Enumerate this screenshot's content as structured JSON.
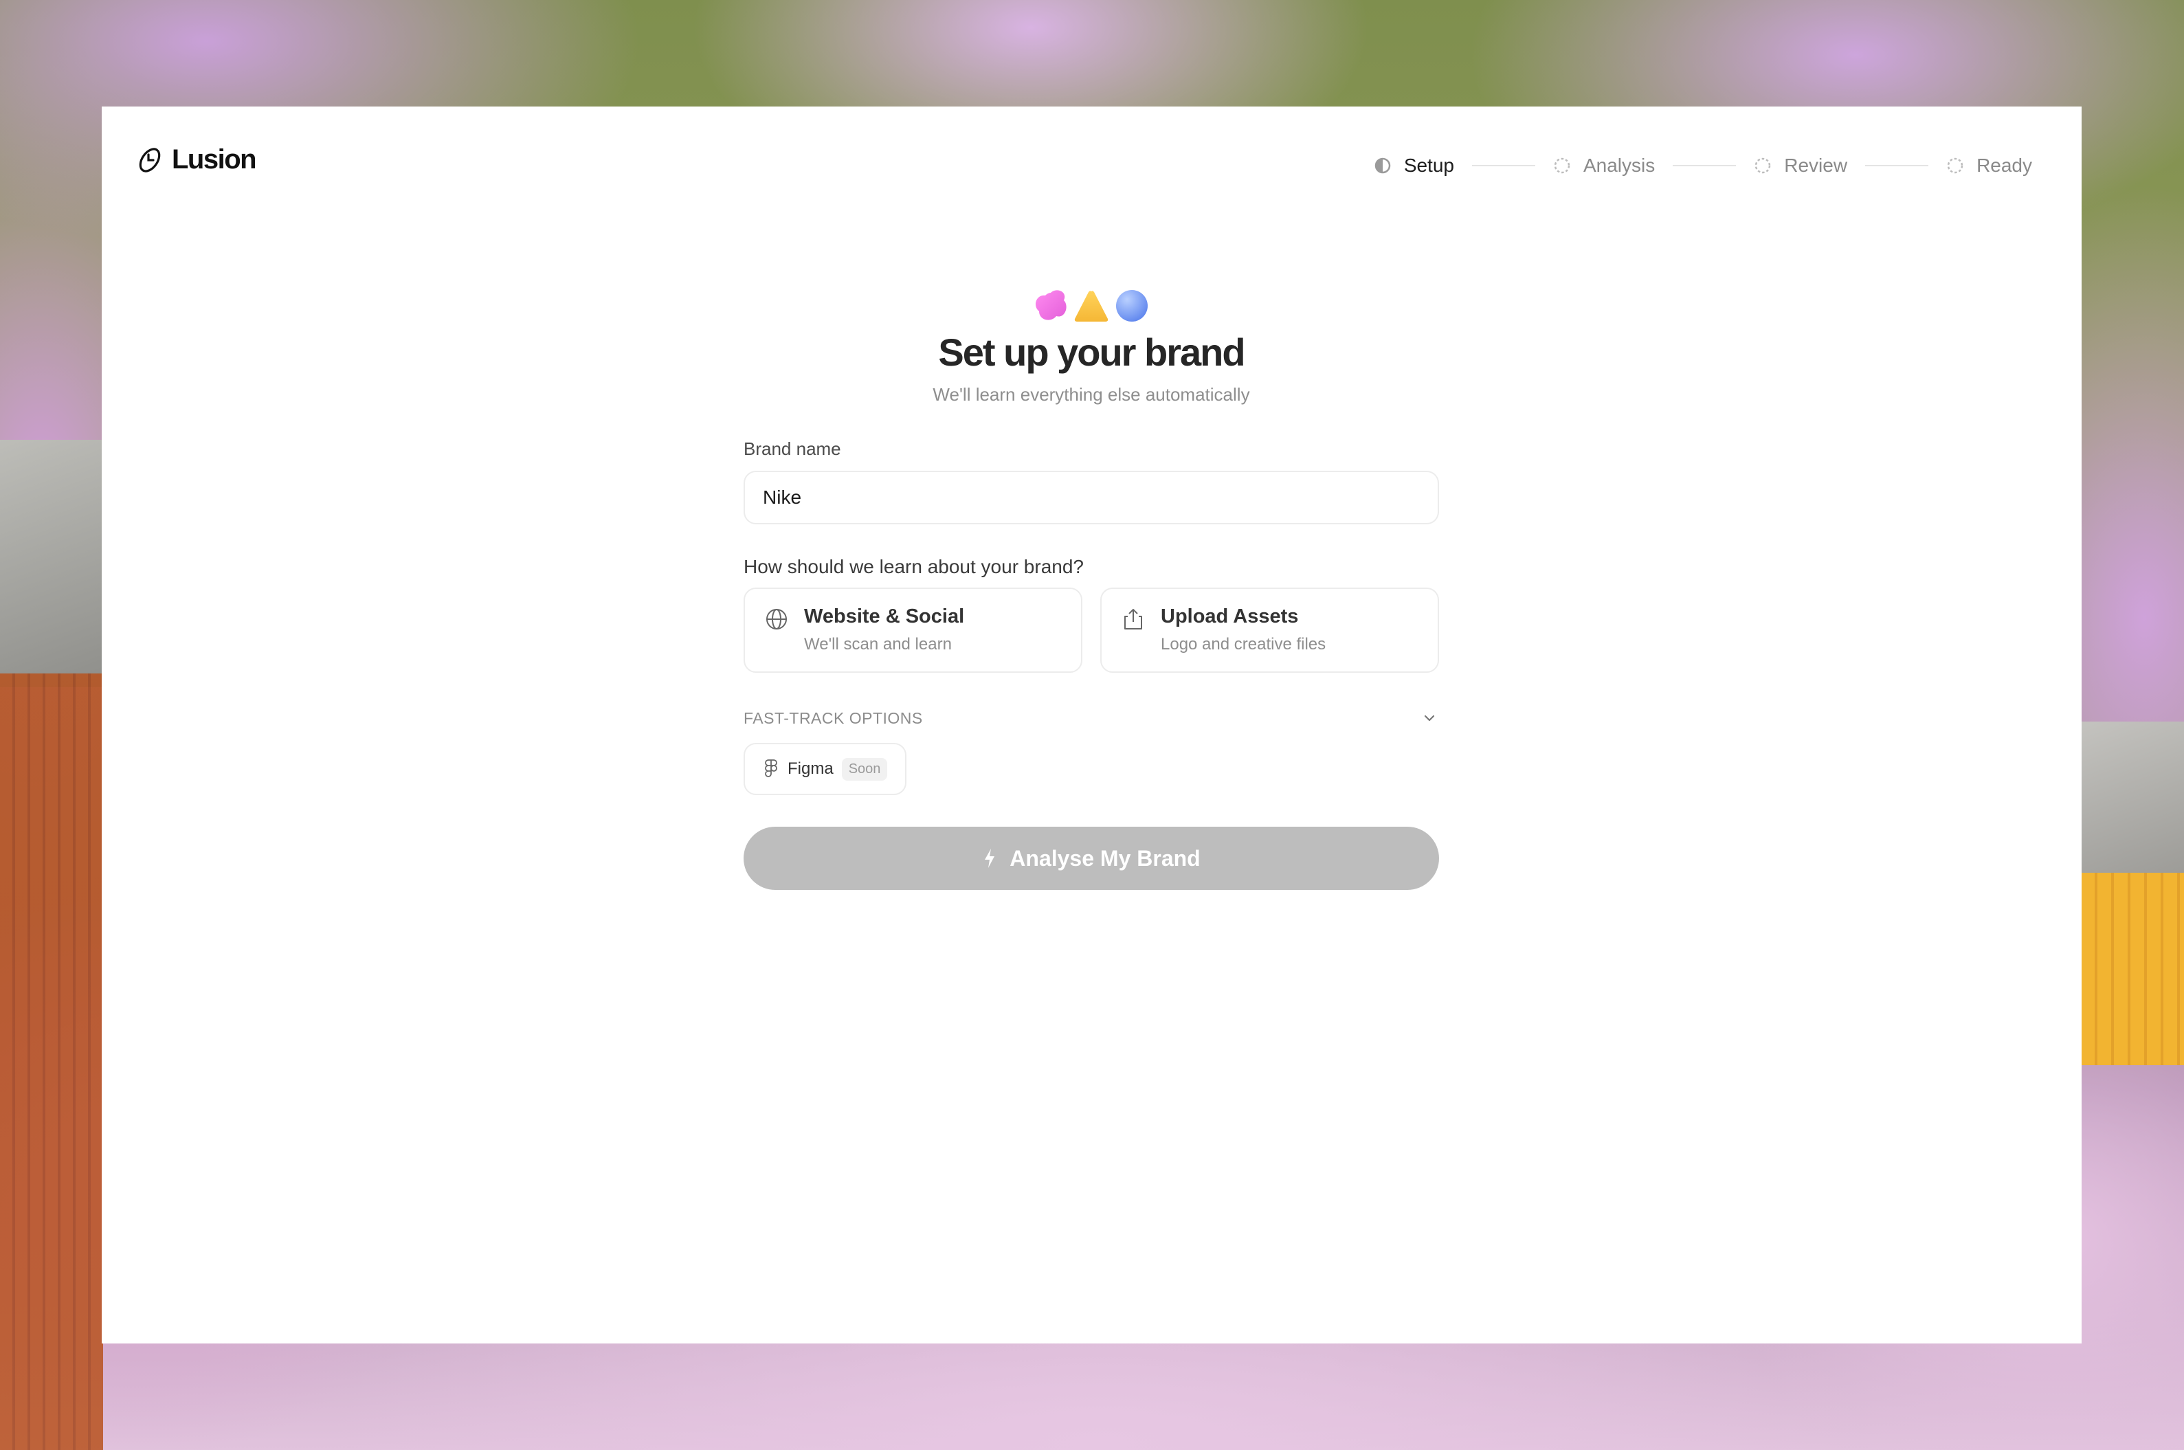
{
  "brand": {
    "logo_text": "Lusion"
  },
  "steps": [
    {
      "label": "Setup",
      "state": "active"
    },
    {
      "label": "Analysis",
      "state": "pending"
    },
    {
      "label": "Review",
      "state": "pending"
    },
    {
      "label": "Ready",
      "state": "pending"
    }
  ],
  "hero": {
    "title": "Set up your brand",
    "subtitle": "We'll learn everything else automatically",
    "shape_colors": [
      "#f06fe6",
      "#f7c74a",
      "#7fa6f7"
    ]
  },
  "form": {
    "brand_name_label": "Brand name",
    "brand_name_value": "Nike",
    "question": "How should we learn about your brand?",
    "options": [
      {
        "title": "Website & Social",
        "subtitle": "We'll scan and learn",
        "icon": "globe-icon"
      },
      {
        "title": "Upload Assets",
        "subtitle": "Logo and creative files",
        "icon": "upload-icon"
      }
    ],
    "fast_track_label": "FAST-TRACK OPTIONS",
    "figma_label": "Figma",
    "figma_badge": "Soon",
    "cta_label": "Analyse My Brand"
  },
  "colors": {
    "cta_disabled": "#bdbdbd",
    "panel": "#ffffff"
  }
}
